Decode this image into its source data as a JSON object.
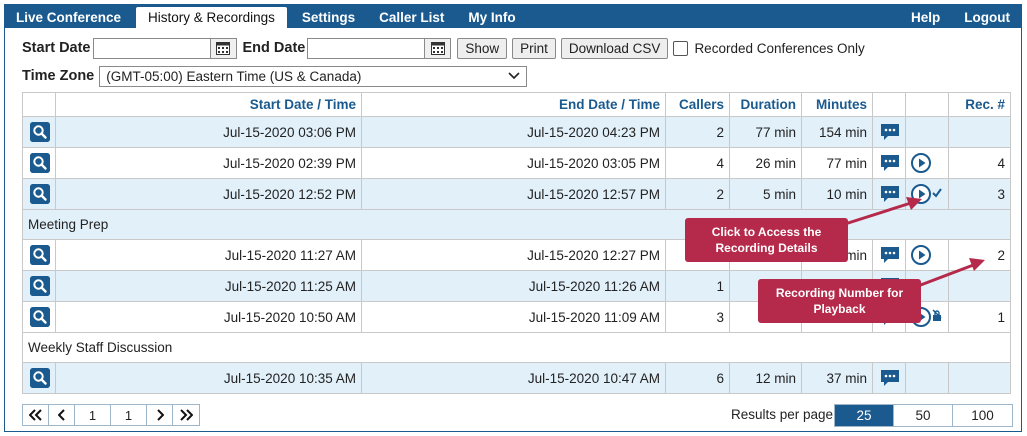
{
  "nav": {
    "tabs": [
      "Live Conference",
      "History & Recordings",
      "Settings",
      "Caller List",
      "My Info"
    ],
    "active_tab": 1,
    "right": [
      "Help",
      "Logout"
    ]
  },
  "filters": {
    "start_date_label": "Start Date",
    "end_date_label": "End Date",
    "start_date_value": "",
    "end_date_value": "",
    "show_label": "Show",
    "print_label": "Print",
    "csv_label": "Download CSV",
    "recorded_only_label": "Recorded Conferences Only",
    "timezone_label": "Time Zone",
    "timezone_value": "(GMT-05:00) Eastern Time (US & Canada)"
  },
  "table": {
    "headers": [
      "Start Date / Time",
      "End Date / Time",
      "Callers",
      "Duration",
      "Minutes",
      "Rec. #"
    ],
    "rows": [
      {
        "start": "Jul-15-2020 03:06 PM",
        "end": "Jul-15-2020 04:23 PM",
        "callers": "2",
        "duration": "77 min",
        "minutes": "154 min",
        "play": "",
        "rec": ""
      },
      {
        "start": "Jul-15-2020 02:39 PM",
        "end": "Jul-15-2020 03:05 PM",
        "callers": "4",
        "duration": "26 min",
        "minutes": "77 min",
        "play": "play",
        "rec": "4"
      },
      {
        "start": "Jul-15-2020 12:52 PM",
        "end": "Jul-15-2020 12:57 PM",
        "callers": "2",
        "duration": "5 min",
        "minutes": "10 min",
        "play": "play-check",
        "rec": "3"
      },
      {
        "title": "Meeting Prep"
      },
      {
        "start": "Jul-15-2020 11:27 AM",
        "end": "Jul-15-2020 12:27 PM",
        "callers": "",
        "duration": "",
        "minutes": "min",
        "play": "play",
        "rec": "2"
      },
      {
        "start": "Jul-15-2020 11:25 AM",
        "end": "Jul-15-2020 11:26 AM",
        "callers": "1",
        "duration": "",
        "minutes": "",
        "play": "",
        "rec": ""
      },
      {
        "start": "Jul-15-2020 10:50 AM",
        "end": "Jul-15-2020 11:09 AM",
        "callers": "3",
        "duration": "",
        "minutes": "",
        "play": "play-lock",
        "rec": "1"
      },
      {
        "title": "Weekly Staff Discussion"
      },
      {
        "start": "Jul-15-2020 10:35 AM",
        "end": "Jul-15-2020 10:47 AM",
        "callers": "6",
        "duration": "12 min",
        "minutes": "37 min",
        "play": "",
        "rec": ""
      }
    ]
  },
  "pager": {
    "page_input": "1",
    "total_pages": "1"
  },
  "results_per_page": {
    "label": "Results per page",
    "options": [
      "25",
      "50",
      "100"
    ],
    "selected": 0
  },
  "callouts": {
    "recording_details": "Click to Access the Recording Details",
    "recording_number": "Recording Number for Playback"
  },
  "colors": {
    "brand": "#1a5a8e",
    "row_alt": "#e2f0fa",
    "callout": "#b5294a"
  }
}
